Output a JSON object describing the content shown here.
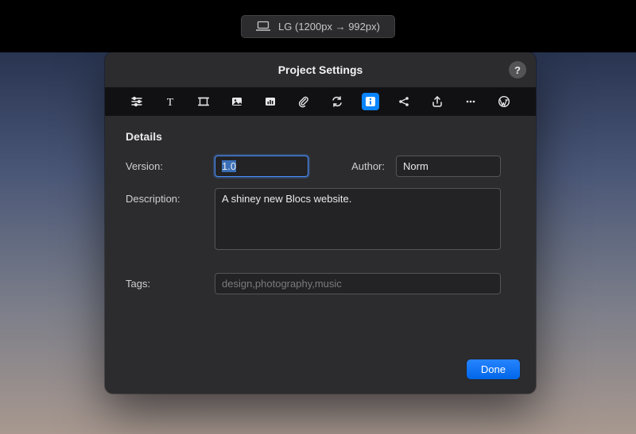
{
  "topbar": {
    "breakpoint_label": "LG (1200px → 992px)"
  },
  "modal": {
    "title": "Project Settings",
    "help_label": "?",
    "tabs_active_index": 7
  },
  "details": {
    "section_title": "Details",
    "version_label": "Version:",
    "version_value": "1.0",
    "author_label": "Author:",
    "author_value": "Norm",
    "description_label": "Description:",
    "description_value": "A shiney new Blocs website.",
    "tags_label": "Tags:",
    "tags_placeholder": "design,photography,music",
    "tags_value": ""
  },
  "footer": {
    "done_label": "Done"
  }
}
